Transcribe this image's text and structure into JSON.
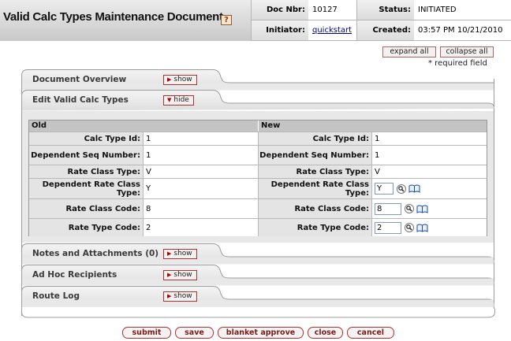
{
  "header": {
    "title": "Valid Calc Types Maintenance Document",
    "doc_nbr_label": "Doc Nbr:",
    "doc_nbr": "10127",
    "status_label": "Status:",
    "status": "INITIATED",
    "initiator_label": "Initiator:",
    "initiator": "quickstart",
    "created_label": "Created:",
    "created": "03:57 PM 10/21/2010"
  },
  "top_buttons": {
    "expand_all": "expand all",
    "collapse_all": "collapse all"
  },
  "required_note": "* required field",
  "tabs": [
    {
      "label": "Document Overview",
      "toggle": "show"
    },
    {
      "label": "Edit Valid Calc Types",
      "toggle": "hide"
    },
    {
      "label": "Notes and Attachments (0)",
      "toggle": "show"
    },
    {
      "label": "Ad Hoc Recipients",
      "toggle": "show"
    },
    {
      "label": "Route Log",
      "toggle": "show"
    }
  ],
  "edit": {
    "old_header": "Old",
    "new_header": "New",
    "rows": [
      {
        "label": "Calc Type Id:",
        "old": "1",
        "new": "1"
      },
      {
        "label": "Dependent Seq Number:",
        "old": "1",
        "new": "1"
      },
      {
        "label": "Rate Class Type:",
        "old": "V",
        "new": "V"
      },
      {
        "label": "Dependent Rate Class Type:",
        "old": "Y",
        "new": "Y"
      },
      {
        "label": "Rate Class Code:",
        "old": "8",
        "new": "8"
      },
      {
        "label": "Rate Type Code:",
        "old": "2",
        "new": "2"
      }
    ]
  },
  "bottom_buttons": {
    "submit": "submit",
    "save": "save",
    "blanket_approve": "blanket approve",
    "close": "close",
    "cancel": "cancel"
  },
  "colors": {
    "header_gray": "#c8c8c8",
    "button_border": "#aa3333",
    "label_bg": "#e4e4e4",
    "column_header_bg": "#c4c4c4",
    "link": "#000088"
  }
}
